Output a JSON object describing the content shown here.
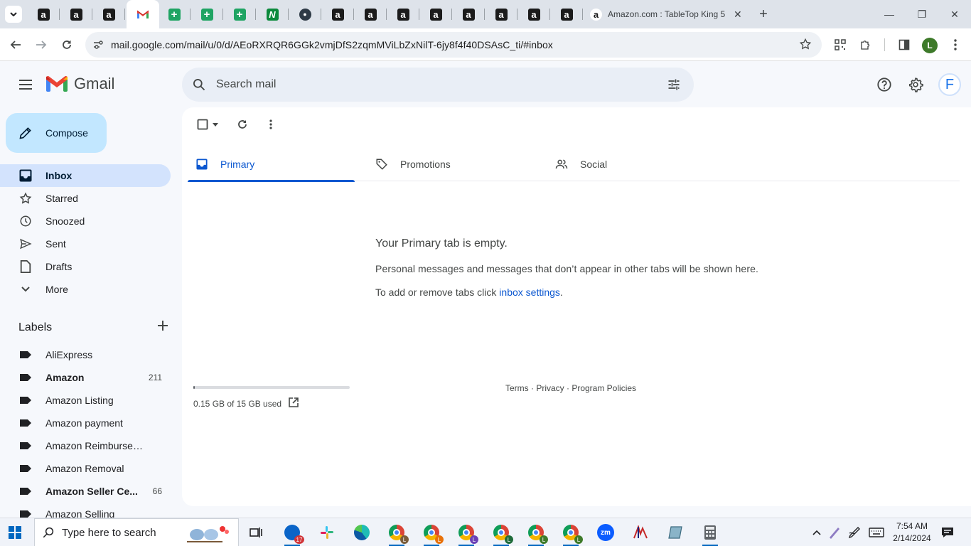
{
  "browser": {
    "pinned_tabs": [
      {
        "icon": "amazon-favicon",
        "glyph": "a"
      },
      {
        "icon": "amazon-favicon",
        "glyph": "a"
      },
      {
        "icon": "amazon-favicon",
        "glyph": "a"
      },
      {
        "icon": "gmail-favicon",
        "glyph": "M"
      },
      {
        "icon": "sheets-favicon",
        "glyph": "+"
      },
      {
        "icon": "sheets-favicon",
        "glyph": "+"
      },
      {
        "icon": "sheets-favicon",
        "glyph": "+"
      },
      {
        "icon": "green-app-favicon",
        "glyph": "N"
      },
      {
        "icon": "globe-favicon",
        "glyph": "●"
      },
      {
        "icon": "amazon-favicon",
        "glyph": "a"
      },
      {
        "icon": "amazon-favicon",
        "glyph": "a"
      },
      {
        "icon": "amazon-favicon",
        "glyph": "a"
      },
      {
        "icon": "amazon-favicon",
        "glyph": "a"
      },
      {
        "icon": "amazon-favicon",
        "glyph": "a"
      },
      {
        "icon": "amazon-favicon",
        "glyph": "a"
      },
      {
        "icon": "amazon-favicon",
        "glyph": "a"
      },
      {
        "icon": "amazon-favicon",
        "glyph": "a"
      }
    ],
    "active_tab_title": "Amazon.com : TableTop King 5",
    "url": "mail.google.com/mail/u/0/d/AEoRXRQR6GGk2vmjDfS2zqmMViLbZxNilT-6jy8f4f40DSAsC_ti/#inbox",
    "profile_initial": "L"
  },
  "gmail": {
    "logo_text": "Gmail",
    "search_placeholder": "Search mail",
    "account_initial": "F",
    "compose_label": "Compose",
    "nav": [
      {
        "label": "Inbox",
        "icon": "inbox-icon",
        "active": true
      },
      {
        "label": "Starred",
        "icon": "star-icon"
      },
      {
        "label": "Snoozed",
        "icon": "clock-icon"
      },
      {
        "label": "Sent",
        "icon": "send-icon"
      },
      {
        "label": "Drafts",
        "icon": "draft-icon"
      },
      {
        "label": "More",
        "icon": "chevron-down-icon"
      }
    ],
    "labels_title": "Labels",
    "labels": [
      {
        "name": "AliExpress",
        "count": ""
      },
      {
        "name": "Amazon",
        "count": "211",
        "bold": true
      },
      {
        "name": "Amazon Listing",
        "count": ""
      },
      {
        "name": "Amazon payment",
        "count": ""
      },
      {
        "name": "Amazon Reimbursemen...",
        "count": ""
      },
      {
        "name": "Amazon Removal",
        "count": ""
      },
      {
        "name": "Amazon Seller Ce...",
        "count": "66",
        "bold": true
      },
      {
        "name": "Amazon Selling",
        "count": ""
      }
    ],
    "tabs": [
      {
        "label": "Primary",
        "icon": "inbox-icon",
        "active": true
      },
      {
        "label": "Promotions",
        "icon": "tag-icon"
      },
      {
        "label": "Social",
        "icon": "people-icon"
      }
    ],
    "empty": {
      "heading": "Your Primary tab is empty.",
      "line1": "Personal messages and messages that don’t appear in other tabs will be shown here.",
      "line2_prefix": "To add or remove tabs click ",
      "line2_link": "inbox settings",
      "line2_suffix": "."
    },
    "storage": {
      "text": "0.15 GB of 15 GB used",
      "fraction": 0.01
    },
    "footer": "Terms · Privacy · Program Policies"
  },
  "taskbar": {
    "search_placeholder": "Type here to search",
    "mail_badge": "17",
    "time": "7:54 AM",
    "date": "2/14/2024",
    "zoom_label": "zm"
  },
  "colors": {
    "accent": "#0b57d0",
    "compose_bg": "#c2e7ff",
    "nav_active_bg": "#d3e3fd"
  }
}
